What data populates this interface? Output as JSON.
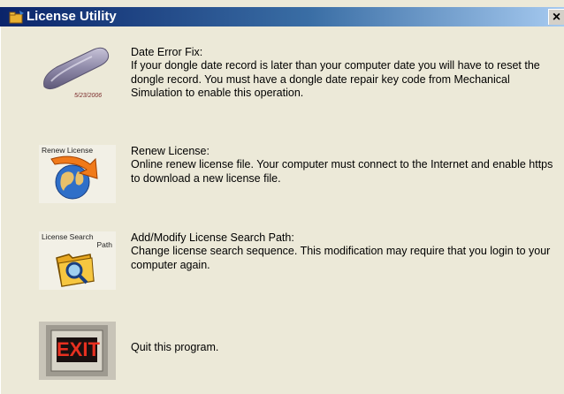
{
  "window": {
    "title": "License Utility",
    "close_label": "×"
  },
  "options": [
    {
      "heading": "Date Error Fix:",
      "description": "If your dongle date record is later than your computer date you will have to reset the dongle record. You must have a dongle date repair key code from Mechanical Simulation to enable this operation.",
      "icon": "usb-dongle-icon",
      "icon_text": "5/23/2006"
    },
    {
      "heading": "Renew License:",
      "description": "Online renew license file. Your computer must connect to the Internet and enable https to download a new license file.",
      "icon": "globe-arrow-icon",
      "icon_text": "Renew License"
    },
    {
      "heading": "Add/Modify License Search Path:",
      "description": "Change license search sequence. This modification may require that you login to your computer again.",
      "icon": "folder-magnifier-icon",
      "icon_text": "License Search",
      "icon_text2": "Path"
    },
    {
      "heading": "",
      "description": "Quit this program.",
      "icon": "exit-sign-icon",
      "icon_text": "EXIT"
    }
  ],
  "colors": {
    "titlebar_start": "#0a246a",
    "titlebar_end": "#a6caf0",
    "background": "#ece9d8"
  }
}
